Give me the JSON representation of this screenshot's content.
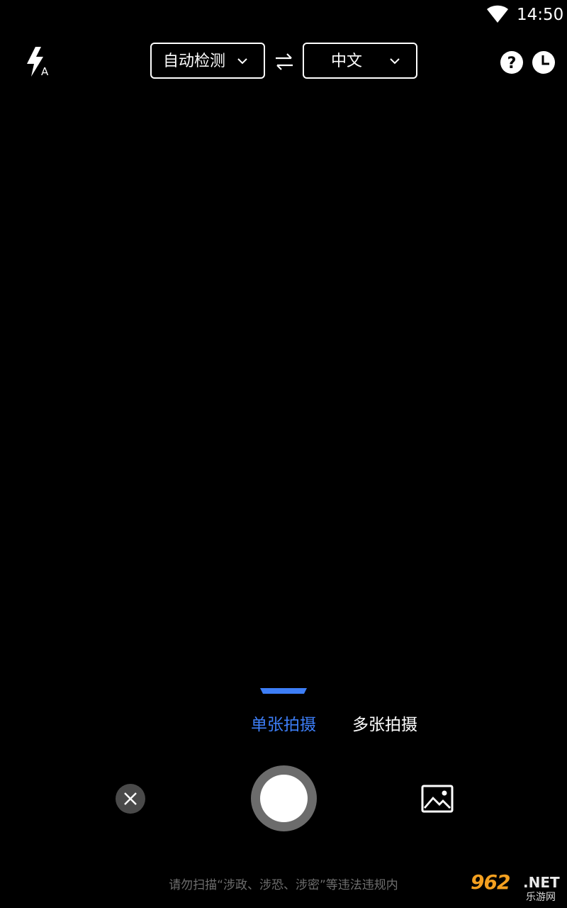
{
  "status_bar": {
    "time": "14:50",
    "wifi_icon": "wifi-icon"
  },
  "top_bar": {
    "flash_icon": "flash-auto-icon",
    "source_language": "自动检测",
    "target_language": "中文",
    "swap_icon": "swap-arrows-icon",
    "help_icon": "help-icon",
    "history_icon": "history-clock-icon"
  },
  "modes": {
    "single": "单张拍摄",
    "multi": "多张拍摄",
    "active_color": "#3d7ef7"
  },
  "controls": {
    "close_icon": "close-icon",
    "shutter_icon": "shutter-icon",
    "gallery_icon": "gallery-image-icon"
  },
  "footer": {
    "disclaimer": "请勿扫描“涉政、涉恐、涉密”等违法违规内"
  },
  "watermark": {
    "logo": "962",
    "suffix": ".NET",
    "subtitle": "乐游网"
  }
}
